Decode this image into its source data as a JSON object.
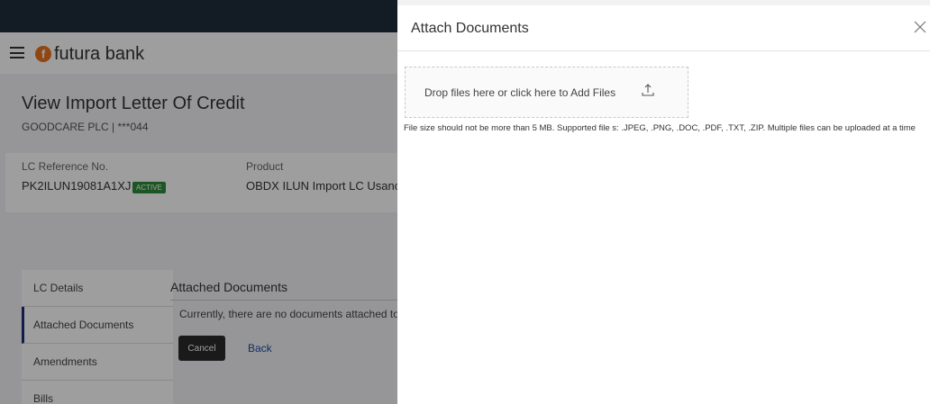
{
  "brand": {
    "name": "futura bank"
  },
  "page": {
    "title": "View Import Letter Of Credit",
    "subtitle": "GOODCARE PLC | ***044"
  },
  "lc": {
    "ref_label": "LC Reference No.",
    "ref_value": "PK2ILUN19081A1XJ",
    "status_badge": "ACTIVE",
    "product_label": "Product",
    "product_value": "OBDX ILUN Import LC Usance"
  },
  "nav": {
    "items": [
      {
        "label": "LC Details"
      },
      {
        "label": "Attached Documents"
      },
      {
        "label": "Amendments"
      },
      {
        "label": "Bills"
      }
    ]
  },
  "documents": {
    "title": "Attached Documents",
    "empty_message": "Currently, there are no documents attached to",
    "cancel_label": "Cancel",
    "back_label": "Back"
  },
  "panel": {
    "title": "Attach Documents",
    "dropzone_text": "Drop files here or click here to Add Files",
    "help_text": "File size should not be more than 5 MB. Supported file s: .JPEG, .PNG, .DOC, .PDF, .TXT, .ZIP. Multiple files can be uploaded at a time"
  },
  "colors": {
    "topbar": "#1f2d3d",
    "active_badge": "#2e8b3b",
    "brand_accent": "#e8731c",
    "link": "#1f4aa3"
  },
  "icons": {
    "menu": "hamburger-icon",
    "logo": "futura-logo-icon",
    "close": "close-icon",
    "upload": "upload-icon"
  }
}
